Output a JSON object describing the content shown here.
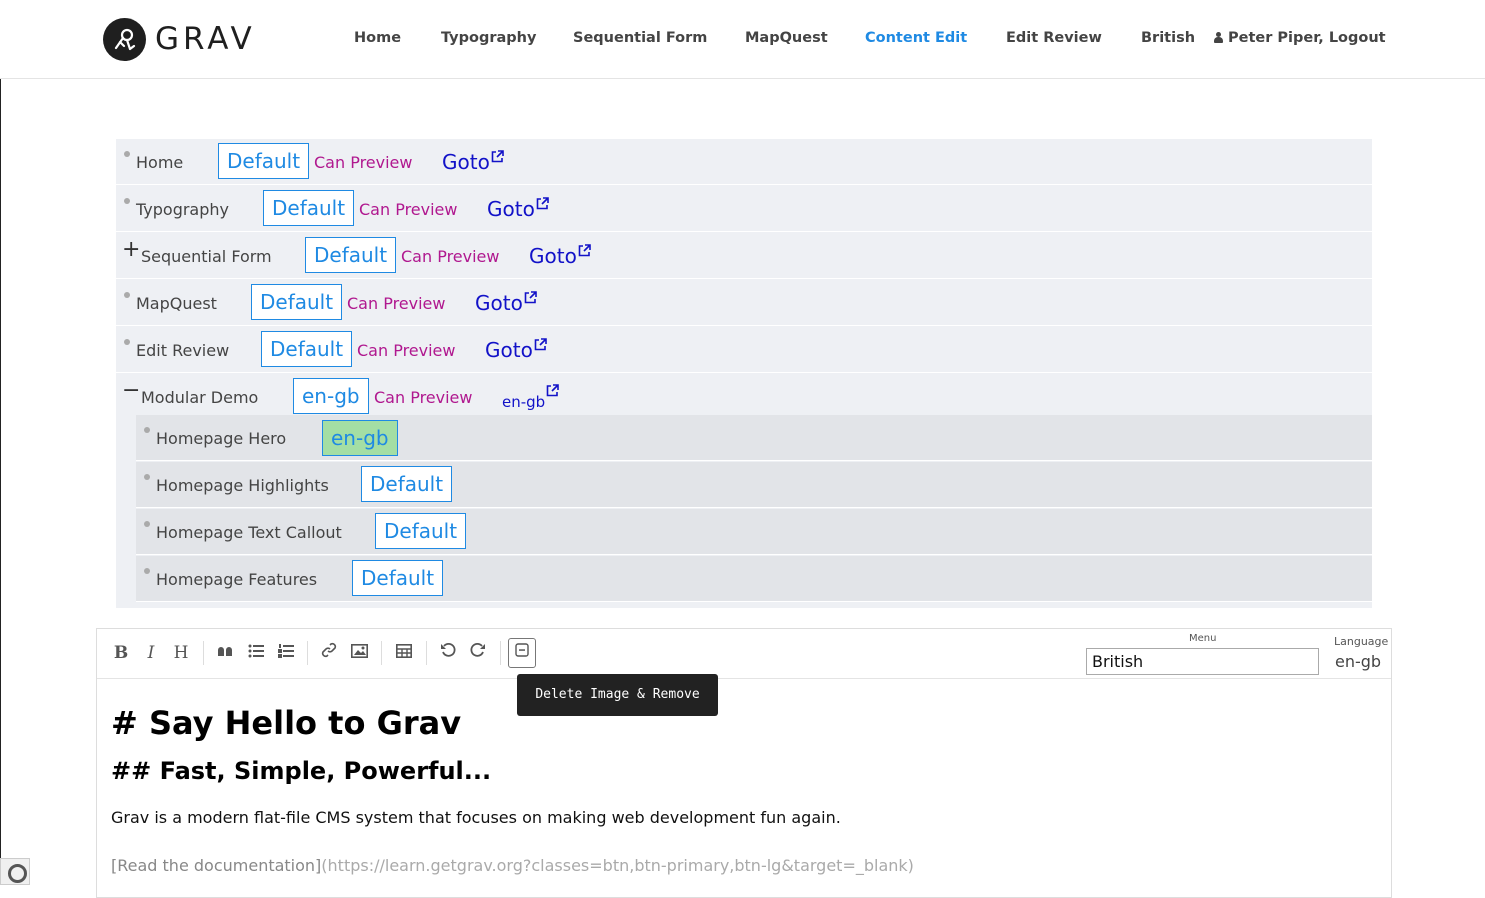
{
  "header": {
    "logo_text": "GRAV",
    "nav": [
      {
        "label": "Home"
      },
      {
        "label": "Typography"
      },
      {
        "label": "Sequential Form"
      },
      {
        "label": "MapQuest"
      },
      {
        "label": "Content Edit",
        "active": true
      },
      {
        "label": "Edit Review"
      },
      {
        "label": "British"
      },
      {
        "label": "Peter Piper, Logout"
      }
    ],
    "active_color": "#1f8ae3"
  },
  "tree": {
    "rows": [
      {
        "label": "Home",
        "tag": "Default",
        "preview": "Can Preview",
        "goto": "Goto"
      },
      {
        "label": "Typography",
        "tag": "Default",
        "preview": "Can Preview",
        "goto": "Goto"
      },
      {
        "label": "Sequential Form",
        "toggle": "+",
        "tag": "Default",
        "preview": "Can Preview",
        "goto": "Goto"
      },
      {
        "label": "MapQuest",
        "tag": "Default",
        "preview": "Can Preview",
        "goto": "Goto"
      },
      {
        "label": "Edit Review",
        "tag": "Default",
        "preview": "Can Preview",
        "goto": "Goto"
      },
      {
        "label": "Modular Demo",
        "toggle": "−",
        "tag": "en-gb",
        "preview": "Can Preview",
        "goto": "en-gb"
      }
    ],
    "children": [
      {
        "label": "Homepage Hero",
        "tag": "en-gb",
        "highlight": true
      },
      {
        "label": "Homepage Highlights",
        "tag": "Default"
      },
      {
        "label": "Homepage Text Callout",
        "tag": "Default"
      },
      {
        "label": "Homepage Features",
        "tag": "Default"
      }
    ]
  },
  "editor": {
    "toolbar": {
      "bold": "B",
      "italic": "I",
      "heading": "H"
    },
    "menu_label": "Menu",
    "menu_value": "British",
    "language_label": "Language",
    "language_value": "en-gb",
    "tooltip": "Delete Image & Remove Link",
    "content": {
      "h1": "# Say Hello to Grav",
      "h2": "## Fast, Simple, Powerful...",
      "paragraph": "Grav is a modern flat-file CMS system that focuses on making web development fun again.",
      "link_text": "[Read the documentation]",
      "link_url": "(https://learn.getgrav.org?classes=btn,btn-primary,btn-lg&target=_blank)"
    }
  }
}
